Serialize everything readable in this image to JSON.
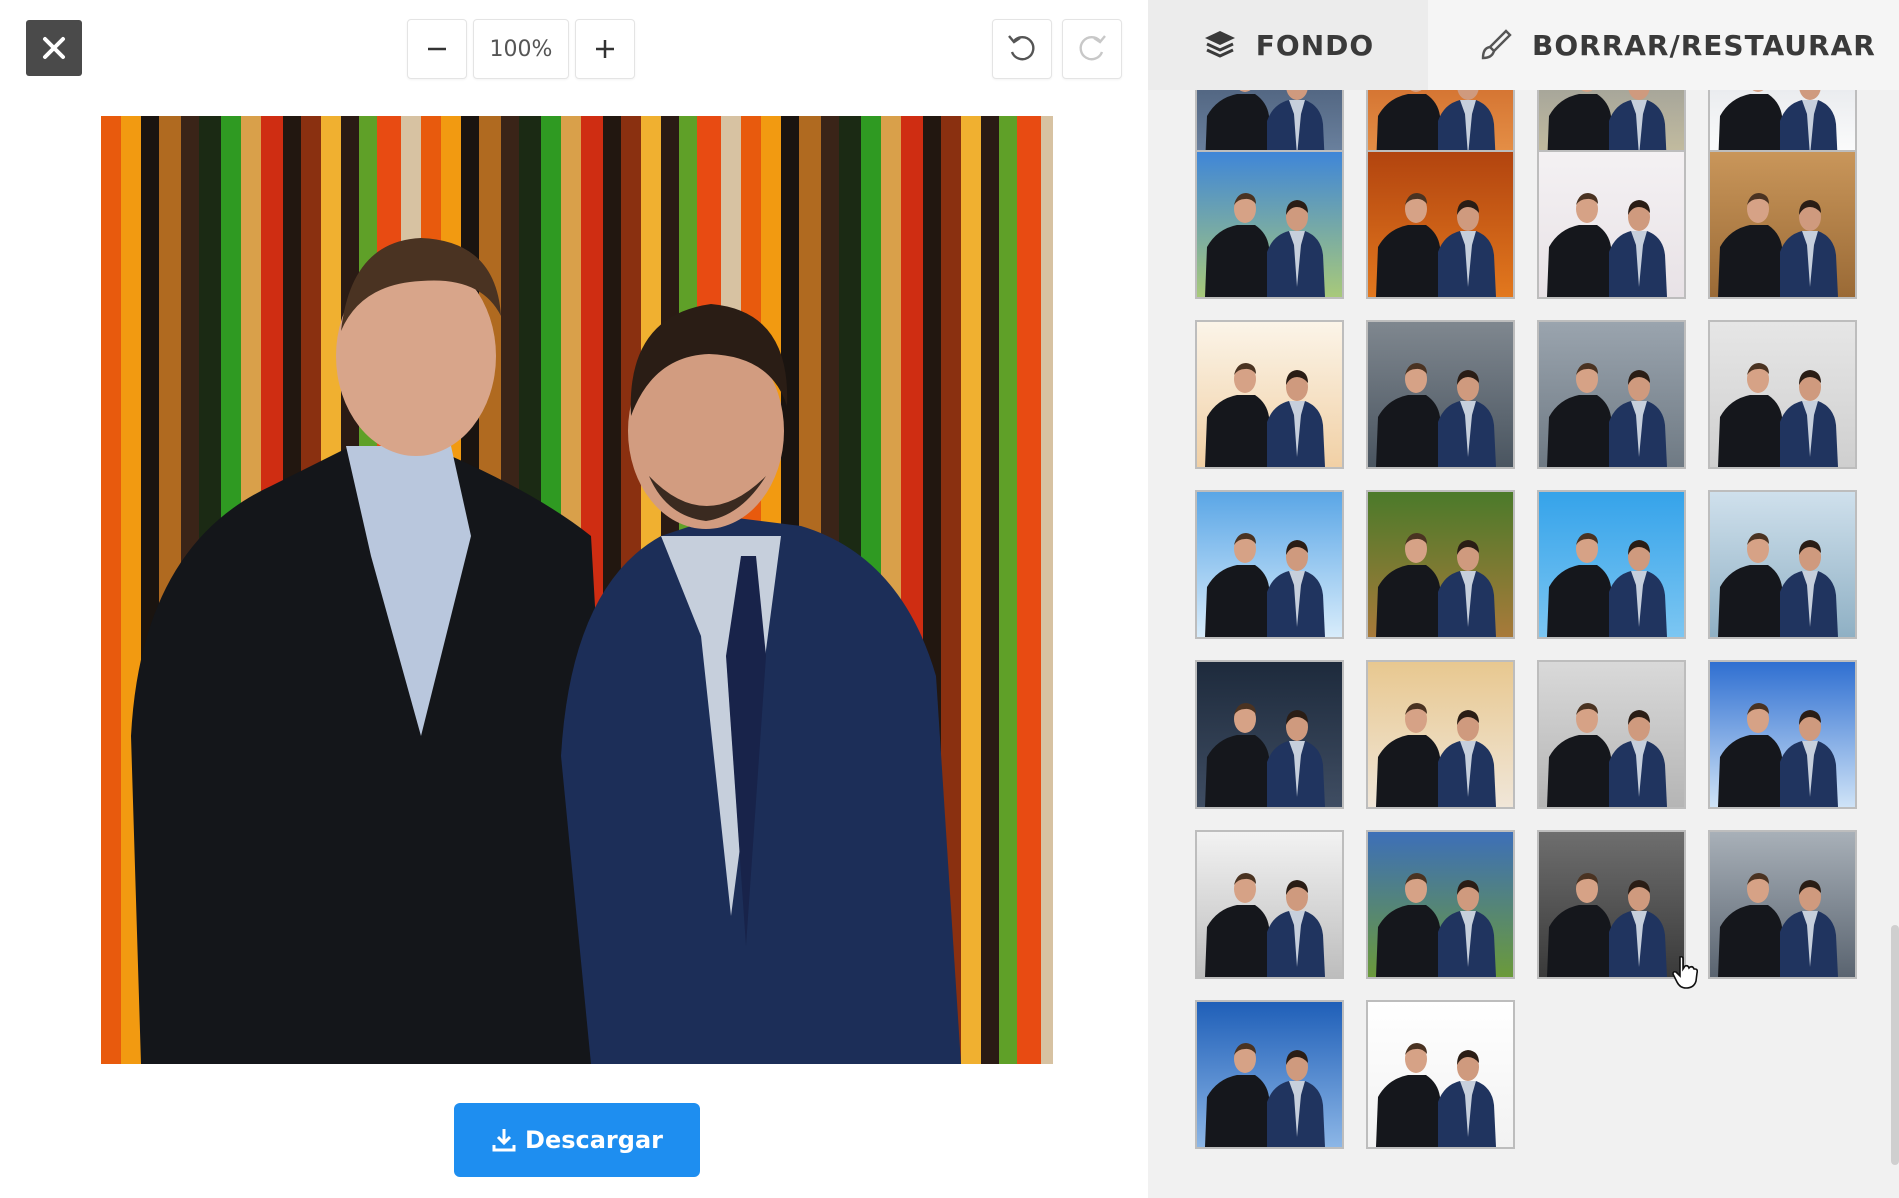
{
  "toolbar": {
    "close_icon": "close-icon",
    "zoom_out_icon": "minus-icon",
    "zoom_level": "100%",
    "zoom_in_icon": "plus-icon",
    "undo_icon": "undo-icon",
    "redo_icon": "redo-icon"
  },
  "canvas": {
    "description_icon": "photo-preview"
  },
  "download": {
    "label": "Descargar",
    "icon": "download-icon",
    "color": "#1e8ef0"
  },
  "tabs": [
    {
      "label": "FONDO",
      "icon": "layers-icon",
      "active": true
    },
    {
      "label": "BORRAR/RESTAURAR",
      "icon": "brush-icon",
      "active": false
    }
  ],
  "backgrounds": [
    {
      "name": "partial-1",
      "colors": [
        "#3a4b66",
        "#6f86a3"
      ]
    },
    {
      "name": "partial-2",
      "colors": [
        "#c45a1e",
        "#e8944a"
      ]
    },
    {
      "name": "partial-3",
      "colors": [
        "#8a8f95",
        "#c8c0a0"
      ]
    },
    {
      "name": "partial-4",
      "colors": [
        "#d7dbe0",
        "#ffffff"
      ]
    },
    {
      "name": "sky-field",
      "colors": [
        "#3f86d8",
        "#a8c97a"
      ]
    },
    {
      "name": "autumn",
      "colors": [
        "#b2440f",
        "#e2781e"
      ]
    },
    {
      "name": "white-room",
      "colors": [
        "#f4f1f3",
        "#e8e2e6"
      ]
    },
    {
      "name": "wood",
      "colors": [
        "#c9965a",
        "#9a6a36"
      ]
    },
    {
      "name": "confetti",
      "colors": [
        "#fbf4e8",
        "#f1d0a5"
      ]
    },
    {
      "name": "mountains",
      "colors": [
        "#7f878f",
        "#4a5560"
      ]
    },
    {
      "name": "street",
      "colors": [
        "#9aa4ae",
        "#6f7a84"
      ]
    },
    {
      "name": "grey-plain",
      "colors": [
        "#e6e6e6",
        "#cfcfcf"
      ]
    },
    {
      "name": "sky-clouds",
      "colors": [
        "#5aa6e6",
        "#d8ecfb"
      ]
    },
    {
      "name": "forest",
      "colors": [
        "#4b7a2a",
        "#a87a3a"
      ]
    },
    {
      "name": "blue-solid",
      "colors": [
        "#35a3ea",
        "#7cc6f2"
      ]
    },
    {
      "name": "lake",
      "colors": [
        "#cfe0ec",
        "#8fb0c4"
      ]
    },
    {
      "name": "night-city",
      "colors": [
        "#1d2a3c",
        "#3f4d62"
      ]
    },
    {
      "name": "fruits",
      "colors": [
        "#e8c890",
        "#f0e6d8"
      ]
    },
    {
      "name": "office",
      "colors": [
        "#d9d9d9",
        "#b5b5b5"
      ]
    },
    {
      "name": "blue-sky",
      "colors": [
        "#2f6fd1",
        "#cfe3f7"
      ]
    },
    {
      "name": "tunnel",
      "colors": [
        "#f2f2f2",
        "#bdbdbd"
      ]
    },
    {
      "name": "green-hills",
      "colors": [
        "#3d6fb8",
        "#6b9a3a"
      ]
    },
    {
      "name": "dark-room",
      "colors": [
        "#6e6e6e",
        "#3a3a3a"
      ]
    },
    {
      "name": "cloudy",
      "colors": [
        "#a8b0b8",
        "#5a6470"
      ]
    },
    {
      "name": "ocean",
      "colors": [
        "#1f5fb8",
        "#8cb6e6"
      ]
    },
    {
      "name": "white-solid",
      "colors": [
        "#ffffff",
        "#f2f2f2"
      ]
    }
  ]
}
